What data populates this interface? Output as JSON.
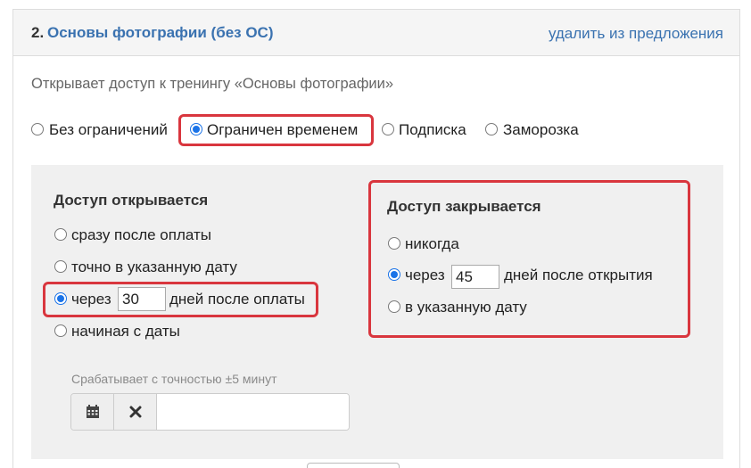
{
  "header": {
    "number": "2.",
    "title": "Основы фотографии (без ОС)",
    "remove_link": "удалить из предложения"
  },
  "description": "Открывает доступ к тренингу «Основы фотографии»",
  "access_types": [
    {
      "label": "Без ограничений",
      "checked": false
    },
    {
      "label": "Ограничен временем",
      "checked": true
    },
    {
      "label": "Подписка",
      "checked": false
    },
    {
      "label": "Заморозка",
      "checked": false
    }
  ],
  "opens": {
    "title": "Доступ открывается",
    "options": {
      "immediately": "сразу после оплаты",
      "exact_date": "точно в указанную дату",
      "after_prefix": "через",
      "after_days": "30",
      "after_suffix": "дней после оплаты",
      "from_date": "начиная с даты"
    },
    "selected": "after",
    "hint": "Срабатывает с точностью ±5 минут"
  },
  "closes": {
    "title": "Доступ закрывается",
    "options": {
      "never": "никогда",
      "after_prefix": "через",
      "after_days": "45",
      "after_suffix": "дней после открытия",
      "at_date": "в указанную дату"
    },
    "selected": "after"
  },
  "colors": {
    "link": "#3a72b0",
    "highlight": "#d9363e",
    "radio_checked": "#1a73e8",
    "panel_bg": "#f0f0f0"
  }
}
